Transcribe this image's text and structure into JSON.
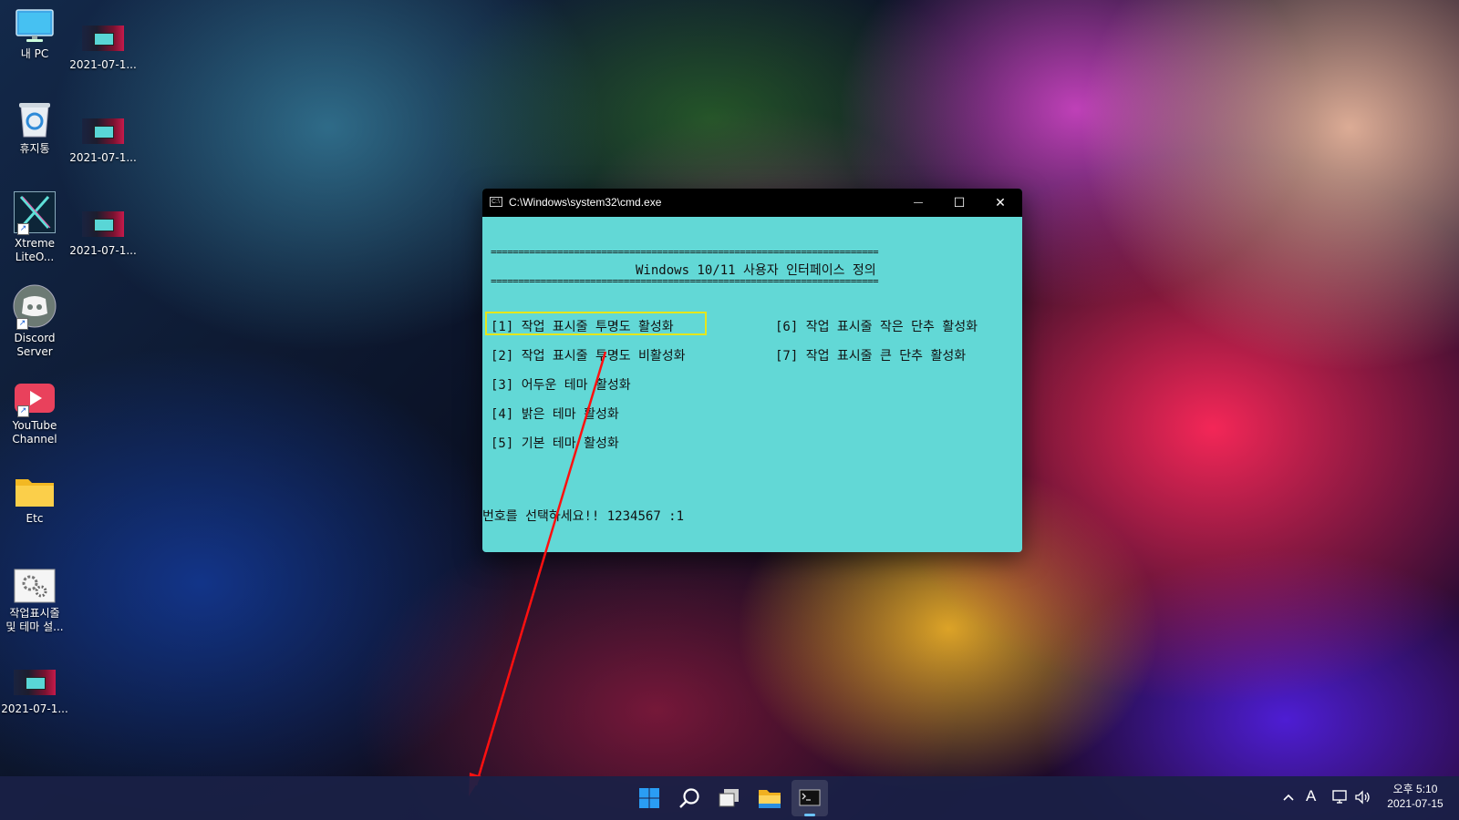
{
  "desktop": {
    "icons": [
      {
        "label": "내 PC"
      },
      {
        "label": "2021-07-1..."
      },
      {
        "label": "휴지통"
      },
      {
        "label": "2021-07-1..."
      },
      {
        "label": "Xtreme LiteO..."
      },
      {
        "label": "2021-07-1..."
      },
      {
        "label": "Discord Server"
      },
      {
        "label": "YouTube Channel"
      },
      {
        "label": "Etc"
      },
      {
        "label": "작업표시줄 및 테마 설..."
      },
      {
        "label": "2021-07-1..."
      }
    ]
  },
  "cmd_window": {
    "title": "C:\\Windows\\system32\\cmd.exe",
    "buttons": {
      "minimize": "—",
      "maximize": "☐",
      "close": "✕"
    },
    "separator": "======================================================================",
    "heading": "Windows 10/11 사용자 인터페이스 정의",
    "options": [
      "[1] 작업 표시줄 투명도 활성화",
      "[2] 작업 표시줄 투명도 비활성화",
      "[3] 어두운 테마 활성화",
      "[4] 밝은 테마 활성화",
      "[5] 기본 테마 활성화",
      "[6] 작업 표시줄 작은 단추 활성화",
      "[7] 작업 표시줄 큰 단추 활성화"
    ],
    "prompt": "번호를 선택하세요!! 1234567 :1",
    "colors": {
      "background": "#62d8d6",
      "highlight": "#e6e61a"
    }
  },
  "taskbar": {
    "apps": [
      {
        "icon": "windows-start-icon"
      },
      {
        "icon": "search-icon"
      },
      {
        "icon": "task-view-icon"
      },
      {
        "icon": "file-explorer-icon"
      },
      {
        "icon": "cmd-terminal-icon"
      }
    ],
    "tray": {
      "input_indicator": "A",
      "clock_time": "오후 5:10",
      "clock_date": "2021-07-15"
    }
  }
}
